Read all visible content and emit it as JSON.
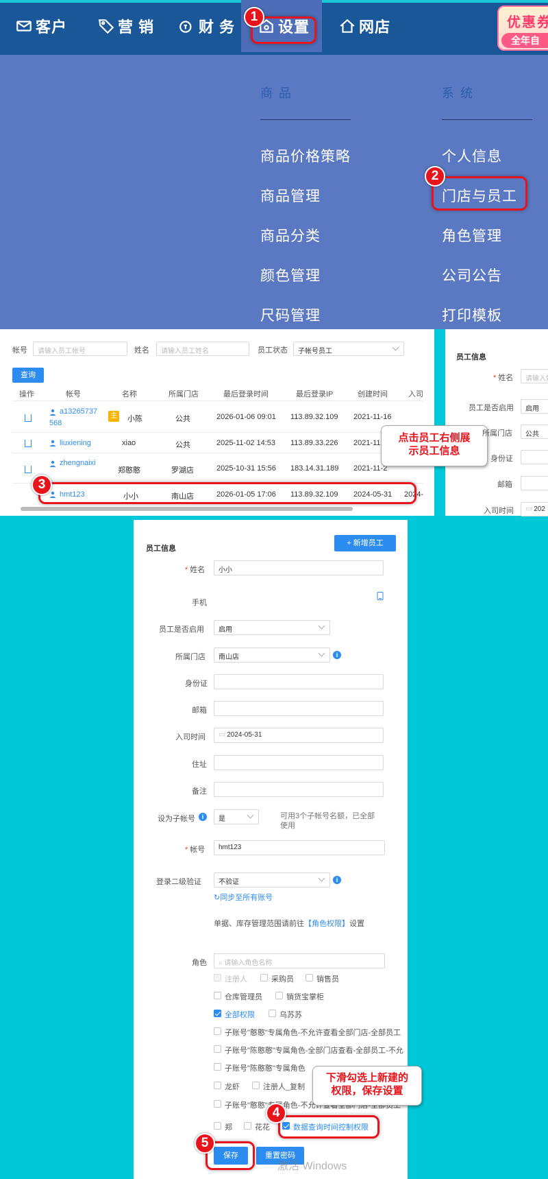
{
  "nav": {
    "customer": "客户",
    "marketing": "营 销",
    "finance": "财 务",
    "settings": "设置",
    "shop": "网店",
    "promo_line1": "优惠券",
    "promo_line2": "全年自"
  },
  "menu": {
    "col1_heading": "商 品",
    "col2_heading": "系 统",
    "col1_items": [
      "商品价格策略",
      "商品管理",
      "商品分类",
      "颜色管理",
      "尺码管理"
    ],
    "col2_items": [
      "个人信息",
      "门店与员工",
      "角色管理",
      "公司公告",
      "打印模板"
    ]
  },
  "steps": [
    "1",
    "2",
    "3",
    "4",
    "5"
  ],
  "tips": {
    "step3": "点击员工右侧展示员工信息",
    "step3_line1": "点击员工右侧展",
    "step3_line2": "示员工信息",
    "step4_line1": "下滑勾选上新建的",
    "step4_line2": "权限，保存设置"
  },
  "filters": {
    "account_label": "帐号",
    "account_placeholder": "请输入员工帐号",
    "name_label": "姓名",
    "name_placeholder": "请输入员工姓名",
    "status_label": "员工状态",
    "status_value": "子帐号员工",
    "query_button": "查询"
  },
  "table": {
    "headers": [
      "操作",
      "帐号",
      "名称",
      "所属门店",
      "最后登录时间",
      "最后登录IP",
      "创建时间",
      "入司"
    ],
    "rows": [
      {
        "account_l1": "a13265737",
        "account_l2": "568",
        "tag": "主",
        "name": "小陈",
        "store": "公共",
        "last_login": "2026-01-06 09:01",
        "ip": "113.89.32.109",
        "created": "2021-11-16"
      },
      {
        "account_l1": "liuxiening",
        "account_l2": "",
        "tag": "",
        "name": "xiao",
        "store": "公共",
        "last_login": "2025-11-02 14:53",
        "ip": "113.89.33.226",
        "created": "2021-11"
      },
      {
        "account_l1": "zhengnaixi",
        "account_l2": "",
        "tag": "",
        "name": "郑憨憨",
        "store": "罗湖店",
        "last_login": "2025-10-31 15:56",
        "ip": "183.14.31.189",
        "created": "2021-11-2"
      },
      {
        "account_l1": "hmt123",
        "account_l2": "",
        "tag": "",
        "name": "小小",
        "store": "南山店",
        "last_login": "2026-01-05 17:06",
        "ip": "113.89.32.109",
        "created": "2024-05-31",
        "extra": "2024-"
      }
    ]
  },
  "side_panel": {
    "title": "员工信息",
    "name_label": "姓名",
    "name_placeholder": "请输入姓",
    "enabled_label": "员工是否启用",
    "enabled_value": "启用",
    "store_label": "所属门店",
    "store_value": "公共",
    "id_label": "身份证",
    "email_label": "邮箱",
    "join_label": "入司时间",
    "join_value": "202"
  },
  "form": {
    "title": "员工信息",
    "add_button": "+ 新增员工",
    "name_label": "姓名",
    "name_value": "小小",
    "phone_label": "手机",
    "enabled_label": "员工是否启用",
    "enabled_value": "启用",
    "store_label": "所属门店",
    "store_value": "南山店",
    "id_label": "身份证",
    "email_label": "邮箱",
    "join_label": "入司时间",
    "join_value": "2024-05-31",
    "address_label": "住址",
    "remark_label": "备注",
    "sub_label": "设为子帐号",
    "sub_value": "是",
    "sub_hint": "可用3个子帐号名额，已全部使用",
    "sub_hint_l1": "可用3个子帐号名额，已全部",
    "sub_hint_l2": "使用",
    "account_label": "帐号",
    "account_value": "hmt123",
    "twofa_label": "登录二级验证",
    "twofa_value": "不验证",
    "sync_link": "同步至所有账号",
    "scope_prefix": "单据、库存管理范围请前往",
    "scope_link": "【角色权限】",
    "scope_suffix": "设置",
    "role_label": "角色",
    "role_placeholder": "请输入角色名称",
    "roles": [
      {
        "label": "注册人",
        "state": "disabled"
      },
      {
        "label": "采购员",
        "state": "off"
      },
      {
        "label": "销售员",
        "state": "off"
      },
      {
        "label": "仓库管理员",
        "state": "off"
      },
      {
        "label": "销货宝掌柜",
        "state": "off"
      },
      {
        "label": "全部权限",
        "state": "on"
      },
      {
        "label": "乌苏苏",
        "state": "off"
      },
      {
        "label": "子账号\"憨憨\"专属角色-不允许查看全部门店-全部员工",
        "state": "off"
      },
      {
        "label": "子账号\"陈憨憨\"专属角色-全部门店查看-全部员工-不允",
        "state": "off"
      },
      {
        "label": "子账号\"陈憨憨\"专属角色",
        "state": "off"
      },
      {
        "label": "龙虾",
        "state": "off"
      },
      {
        "label": "注册人_复制",
        "state": "off"
      },
      {
        "label": "子账号\"憨憨\"专属角色-不允许查看全部门店-全部员工",
        "state": "off"
      },
      {
        "label": "郑",
        "state": "off"
      },
      {
        "label": "花花",
        "state": "off"
      },
      {
        "label": "数据查询时间控制权限",
        "state": "on"
      }
    ],
    "save_button": "保存",
    "reset_button": "重置密码"
  },
  "watermark": "激活 Windows"
}
